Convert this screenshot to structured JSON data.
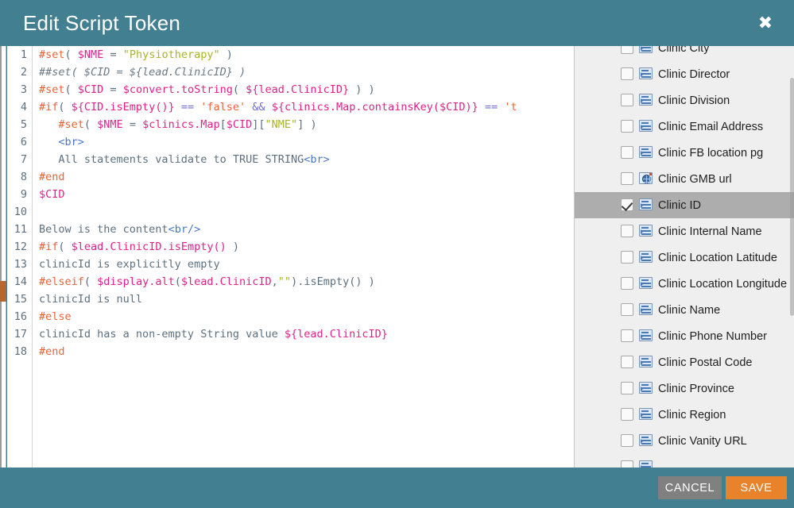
{
  "header": {
    "title": "Edit Script Token",
    "close_label": "✖"
  },
  "editor": {
    "line_numbers": [
      1,
      2,
      3,
      4,
      5,
      6,
      7,
      8,
      9,
      10,
      11,
      12,
      13,
      14,
      15,
      16,
      17,
      18
    ],
    "lines": [
      {
        "n": 1,
        "text": "#set( $NME = \"Physiotherapy\" )"
      },
      {
        "n": 2,
        "text": "##set( $CID = ${lead.ClinicID} )"
      },
      {
        "n": 3,
        "text": "#set( $CID = $convert.toString( ${lead.ClinicID} ) )"
      },
      {
        "n": 4,
        "text": "#if( ${CID.isEmpty()} == 'false' && ${clinics.Map.containsKey($CID)} == 't"
      },
      {
        "n": 5,
        "text": "   #set( $NME = $clinics.Map[$CID][\"NME\"] )"
      },
      {
        "n": 6,
        "text": "   <br>"
      },
      {
        "n": 7,
        "text": "   All statements validate to TRUE STRING<br>"
      },
      {
        "n": 8,
        "text": "#end"
      },
      {
        "n": 9,
        "text": "$CID"
      },
      {
        "n": 10,
        "text": ""
      },
      {
        "n": 11,
        "text": "Below is the content<br/>"
      },
      {
        "n": 12,
        "text": "#if( $lead.ClinicID.isEmpty() )"
      },
      {
        "n": 13,
        "text": "clinicId is explicitly empty"
      },
      {
        "n": 14,
        "text": "#elseif( $display.alt($lead.ClinicID,\"\").isEmpty() )"
      },
      {
        "n": 15,
        "text": "clinicId is null"
      },
      {
        "n": 16,
        "text": "#else"
      },
      {
        "n": 17,
        "text": "clinicId has a non-empty String value ${lead.ClinicID}"
      },
      {
        "n": 18,
        "text": "#end"
      }
    ]
  },
  "token_list": {
    "items": [
      {
        "label": "Clinic City",
        "icon": "text-field-icon",
        "checked": false,
        "selected": false,
        "clipped": "top"
      },
      {
        "label": "Clinic Director",
        "icon": "text-field-icon",
        "checked": false,
        "selected": false
      },
      {
        "label": "Clinic Division",
        "icon": "text-field-icon",
        "checked": false,
        "selected": false
      },
      {
        "label": "Clinic Email Address",
        "icon": "text-field-icon",
        "checked": false,
        "selected": false
      },
      {
        "label": "Clinic FB location pg",
        "icon": "text-field-icon",
        "checked": false,
        "selected": false
      },
      {
        "label": "Clinic GMB url",
        "icon": "url-field-icon",
        "checked": false,
        "selected": false
      },
      {
        "label": "Clinic ID",
        "icon": "text-field-icon",
        "checked": true,
        "selected": true
      },
      {
        "label": "Clinic Internal Name",
        "icon": "text-field-icon",
        "checked": false,
        "selected": false
      },
      {
        "label": "Clinic Location Latitude",
        "icon": "text-field-icon",
        "checked": false,
        "selected": false
      },
      {
        "label": "Clinic Location Longitude",
        "icon": "text-field-icon",
        "checked": false,
        "selected": false
      },
      {
        "label": "Clinic Name",
        "icon": "text-field-icon",
        "checked": false,
        "selected": false
      },
      {
        "label": "Clinic Phone Number",
        "icon": "text-field-icon",
        "checked": false,
        "selected": false
      },
      {
        "label": "Clinic Postal Code",
        "icon": "text-field-icon",
        "checked": false,
        "selected": false
      },
      {
        "label": "Clinic Province",
        "icon": "text-field-icon",
        "checked": false,
        "selected": false
      },
      {
        "label": "Clinic Region",
        "icon": "text-field-icon",
        "checked": false,
        "selected": false
      },
      {
        "label": "Clinic Vanity URL",
        "icon": "text-field-icon",
        "checked": false,
        "selected": false
      },
      {
        "label": "",
        "icon": "text-field-icon",
        "checked": false,
        "selected": false,
        "clipped": "bottom"
      }
    ]
  },
  "footer": {
    "cancel_label": "CANCEL",
    "save_label": "SAVE"
  },
  "colors": {
    "header_teal": "#427f91",
    "save_orange": "#e8832b",
    "cancel_gray": "#808080",
    "list_bg": "#efefef",
    "selected_row": "#adadad",
    "directive": "#e8633a",
    "variable": "#e0218a",
    "string": "#a9b32a",
    "operator": "#6f6fd0",
    "plain_text": "#5c7080",
    "html_tag": "#4a76c8"
  }
}
